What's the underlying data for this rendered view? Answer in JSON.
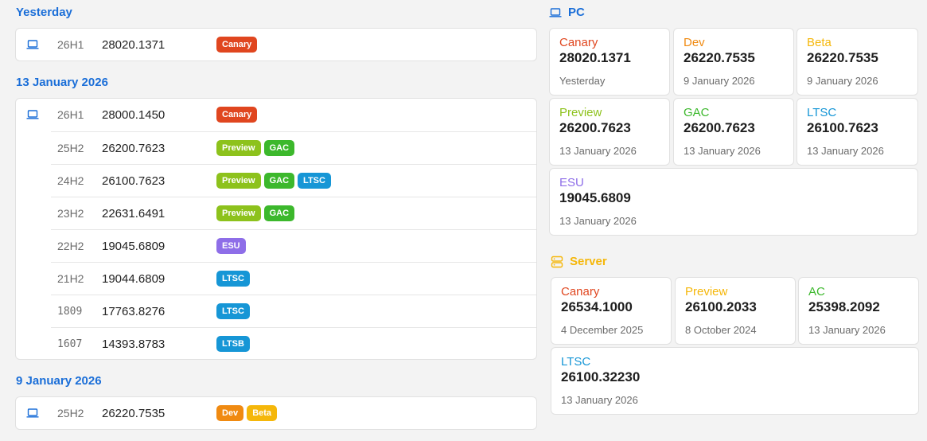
{
  "colors": {
    "accent": "#1a6ed8",
    "canary": "#e0461f",
    "dev": "#f08a11",
    "beta": "#f5b70a",
    "preview": "#8dc21c",
    "gac": "#3cb82c",
    "ltsc": "#1696d6",
    "esu": "#8e6ee8",
    "server": "#f5b70a"
  },
  "left": {
    "groups": [
      {
        "title": "Yesterday",
        "rows": [
          {
            "version": "26H1",
            "build": "28020.1371",
            "tags": [
              "Canary"
            ]
          }
        ]
      },
      {
        "title": "13 January 2026",
        "rows": [
          {
            "version": "26H1",
            "build": "28000.1450",
            "tags": [
              "Canary"
            ]
          },
          {
            "version": "25H2",
            "build": "26200.7623",
            "tags": [
              "Preview",
              "GAC"
            ]
          },
          {
            "version": "24H2",
            "build": "26100.7623",
            "tags": [
              "Preview",
              "GAC",
              "LTSC"
            ]
          },
          {
            "version": "23H2",
            "build": "22631.6491",
            "tags": [
              "Preview",
              "GAC"
            ]
          },
          {
            "version": "22H2",
            "build": "19045.6809",
            "tags": [
              "ESU"
            ]
          },
          {
            "version": "21H2",
            "build": "19044.6809",
            "tags": [
              "LTSC"
            ]
          },
          {
            "version": "1809",
            "build": "17763.8276",
            "tags": [
              "LTSC"
            ]
          },
          {
            "version": "1607",
            "build": "14393.8783",
            "tags": [
              "LTSB"
            ]
          }
        ]
      },
      {
        "title": "9 January 2026",
        "rows": [
          {
            "version": "25H2",
            "build": "26220.7535",
            "tags": [
              "Dev",
              "Beta"
            ]
          }
        ]
      }
    ]
  },
  "pc": {
    "title": "PC",
    "tiles": [
      {
        "channel": "Canary",
        "build": "28020.1371",
        "date": "Yesterday"
      },
      {
        "channel": "Dev",
        "build": "26220.7535",
        "date": "9 January 2026"
      },
      {
        "channel": "Beta",
        "build": "26220.7535",
        "date": "9 January 2026"
      },
      {
        "channel": "Preview",
        "build": "26200.7623",
        "date": "13 January 2026"
      },
      {
        "channel": "GAC",
        "build": "26200.7623",
        "date": "13 January 2026"
      },
      {
        "channel": "LTSC",
        "build": "26100.7623",
        "date": "13 January 2026"
      },
      {
        "channel": "ESU",
        "build": "19045.6809",
        "date": "13 January 2026"
      }
    ]
  },
  "server": {
    "title": "Server",
    "tiles": [
      {
        "channel": "Canary",
        "build": "26534.1000",
        "date": "4 December 2025"
      },
      {
        "channel": "Preview",
        "build": "26100.2033",
        "date": "8 October 2024"
      },
      {
        "channel": "AC",
        "build": "25398.2092",
        "date": "13 January 2026"
      },
      {
        "channel": "LTSC",
        "build": "26100.32230",
        "date": "13 January 2026"
      }
    ]
  }
}
